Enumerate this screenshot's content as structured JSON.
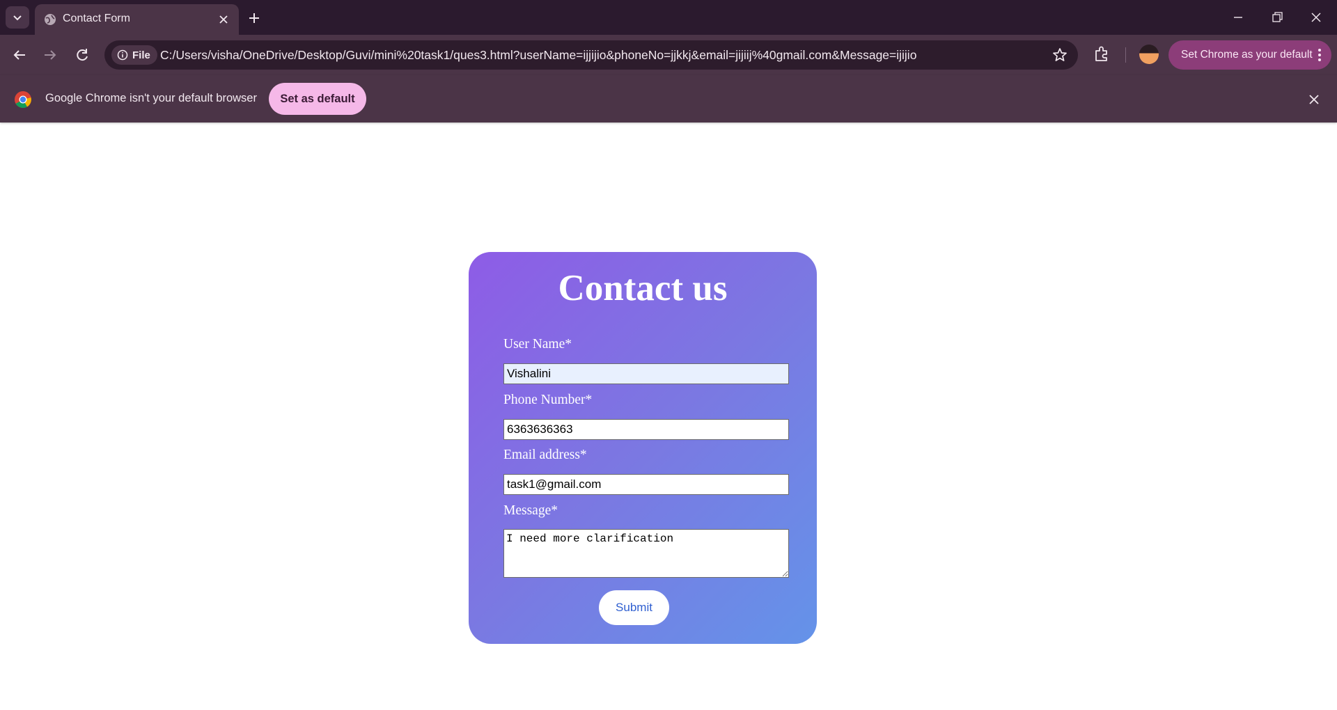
{
  "browser": {
    "tab": {
      "title": "Contact Form"
    },
    "address_bar": {
      "chip_label": "File",
      "url": "C:/Users/visha/OneDrive/Desktop/Guvi/mini%20task1/ques3.html?userName=ijjijio&phoneNo=jjkkj&email=jijiij%40gmail.com&Message=ijijio"
    },
    "default_pill_label": "Set Chrome as your default",
    "infobar": {
      "message": "Google Chrome isn't your default browser",
      "button_label": "Set as default"
    },
    "colors": {
      "frame": "#2b1a2e",
      "toolbar": "#4b3447",
      "accent_pill": "#8c3d79",
      "infobar_button": "#f5b8e8"
    }
  },
  "form": {
    "heading": "Contact us",
    "fields": [
      {
        "label": "User Name*",
        "value": "Vishalini"
      },
      {
        "label": "Phone Number*",
        "value": "6363636363"
      },
      {
        "label": "Email address*",
        "value": "task1@gmail.com"
      },
      {
        "label": "Message*",
        "value": "I need more clarification"
      }
    ],
    "submit_label": "Submit",
    "colors": {
      "gradient_start": "#8e5ce6",
      "gradient_end": "#6493e9",
      "submit_text": "#2f5fd0"
    }
  }
}
